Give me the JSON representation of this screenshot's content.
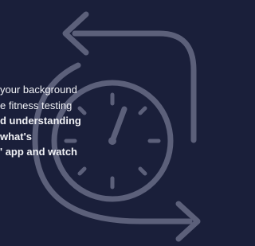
{
  "background_color": "#1a1f3a",
  "graphic": {
    "icon": "cycle-stopwatch-icon",
    "stroke_color": "#5c607a"
  },
  "text_lines": [
    {
      "text": "your background",
      "bold": false
    },
    {
      "text": "e fitness testing",
      "bold": false
    },
    {
      "text": "d understanding",
      "bold": true
    },
    {
      "text": "what's",
      "bold": true
    },
    {
      "text": "' app and watch",
      "bold": true
    }
  ]
}
